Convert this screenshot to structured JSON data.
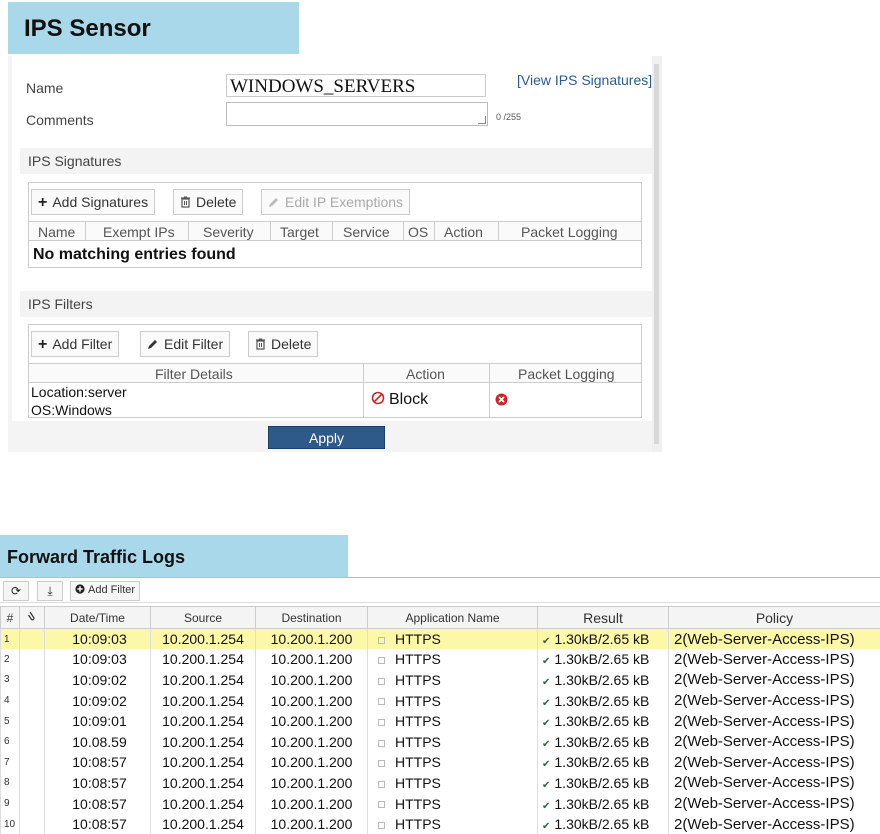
{
  "ips_sensor": {
    "title": "IPS Sensor",
    "name_label": "Name",
    "name_value": "WINDOWS_SERVERS",
    "comments_label": "Comments",
    "comments_value": "",
    "char_count": "0 /255",
    "view_signatures_link": "[View IPS Signatures]",
    "signatures_section": {
      "title": "IPS Signatures",
      "toolbar": {
        "add": "Add Signatures",
        "delete": "Delete",
        "edit_exemptions": "Edit IP Exemptions"
      },
      "columns": [
        "Name",
        "Exempt IPs",
        "Severity",
        "Target",
        "Service",
        "OS",
        "Action",
        "Packet Logging"
      ],
      "empty_message": "No matching entries found"
    },
    "filters_section": {
      "title": "IPS Filters",
      "toolbar": {
        "add": "Add Filter",
        "edit": "Edit Filter",
        "delete": "Delete"
      },
      "columns": [
        "Filter Details",
        "Action",
        "Packet Logging"
      ],
      "rows": [
        {
          "details_line1": "Location:server",
          "details_line2": "OS:Windows",
          "action": "Block",
          "packet_logging": "disabled"
        }
      ]
    },
    "apply_label": "Apply"
  },
  "forward_traffic_logs": {
    "title": "Forward Traffic Logs",
    "toolbar": {
      "add_filter": "Add Filter"
    },
    "columns": [
      "#",
      "",
      "Date/Time",
      "Source",
      "Destination",
      "Application Name",
      "Result",
      "Policy"
    ],
    "rows": [
      {
        "idx": "1",
        "time": "10:09:03",
        "source": "10.200.1.254",
        "destination": "10.200.1.200",
        "app": "HTTPS",
        "result": "1.30kB/2.65 kB",
        "policy": "2(Web-Server-Access-IPS)"
      },
      {
        "idx": "2",
        "time": "10:09:03",
        "source": "10.200.1.254",
        "destination": "10.200.1.200",
        "app": "HTTPS",
        "result": "1.30kB/2.65 kB",
        "policy": "2(Web-Server-Access-IPS)"
      },
      {
        "idx": "3",
        "time": "10:09:02",
        "source": "10.200.1.254",
        "destination": "10.200.1.200",
        "app": "HTTPS",
        "result": "1.30kB/2.65 kB",
        "policy": "2(Web-Server-Access-IPS)"
      },
      {
        "idx": "4",
        "time": "10:09:02",
        "source": "10.200.1.254",
        "destination": "10.200.1.200",
        "app": "HTTPS",
        "result": "1.30kB/2.65 kB",
        "policy": "2(Web-Server-Access-IPS)"
      },
      {
        "idx": "5",
        "time": "10:09:01",
        "source": "10.200.1.254",
        "destination": "10.200.1.200",
        "app": "HTTPS",
        "result": "1.30kB/2.65 kB",
        "policy": "2(Web-Server-Access-IPS)"
      },
      {
        "idx": "6",
        "time": "10.08.59",
        "source": "10.200.1.254",
        "destination": "10.200.1.200",
        "app": "HTTPS",
        "result": "1.30kB/2.65 kB",
        "policy": "2(Web-Server-Access-IPS)"
      },
      {
        "idx": "7",
        "time": "10:08:57",
        "source": "10.200.1.254",
        "destination": "10.200.1.200",
        "app": "HTTPS",
        "result": "1.30kB/2.65 kB",
        "policy": "2(Web-Server-Access-IPS)"
      },
      {
        "idx": "8",
        "time": "10:08:57",
        "source": "10.200.1.254",
        "destination": "10.200.1.200",
        "app": "HTTPS",
        "result": "1.30kB/2.65 kB",
        "policy": "2(Web-Server-Access-IPS)"
      },
      {
        "idx": "9",
        "time": "10:08:57",
        "source": "10.200.1.254",
        "destination": "10.200.1.200",
        "app": "HTTPS",
        "result": "1.30kB/2.65 kB",
        "policy": "2(Web-Server-Access-IPS)"
      },
      {
        "idx": "10",
        "time": "10:08:57",
        "source": "10.200.1.254",
        "destination": "10.200.1.200",
        "app": "HTTPS",
        "result": "1.30kB/2.65 kB",
        "policy": "2(Web-Server-Access-IPS)"
      }
    ],
    "selected_row": "1"
  },
  "colors": {
    "title_band": "#a8d8ea",
    "apply_button": "#2e5a8a",
    "selected_row": "#fdf7a8",
    "block_icon": "#c62828"
  },
  "icons": [
    "refresh-icon",
    "download-icon",
    "plus-icon",
    "trash-icon",
    "pencil-icon",
    "block-icon",
    "disabled-icon",
    "check-icon",
    "attachment-icon"
  ]
}
